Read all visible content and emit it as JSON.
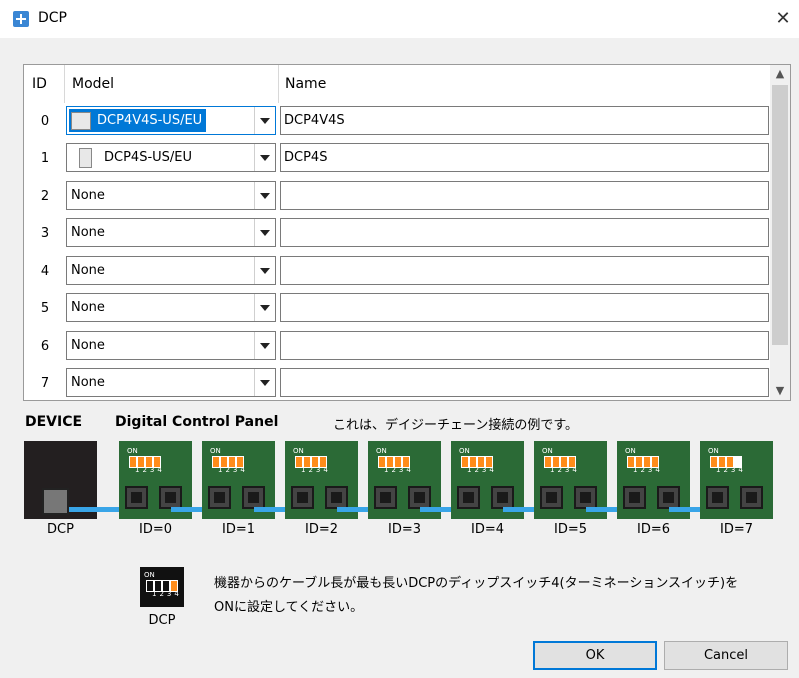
{
  "window": {
    "title": "DCP",
    "close_glyph": "✕"
  },
  "table": {
    "columns": [
      "ID",
      "Model",
      "Name"
    ],
    "rows": [
      {
        "id": "0",
        "model": "DCP4V4S-US/EU",
        "name": "DCP4V4S",
        "icon": "dcp4v4s-icon"
      },
      {
        "id": "1",
        "model": "DCP4S-US/EU",
        "name": "DCP4S",
        "icon": "dcp4s-icon"
      },
      {
        "id": "2",
        "model": "None",
        "name": ""
      },
      {
        "id": "3",
        "model": "None",
        "name": ""
      },
      {
        "id": "4",
        "model": "None",
        "name": ""
      },
      {
        "id": "5",
        "model": "None",
        "name": ""
      },
      {
        "id": "6",
        "model": "None",
        "name": ""
      },
      {
        "id": "7",
        "model": "None",
        "name": ""
      }
    ]
  },
  "diagram": {
    "device_label": "DEVICE",
    "panel_label": "Digital Control Panel",
    "note": "これは、デイジーチェーン接続の例です。",
    "device_port_label": "DCP",
    "id_labels": [
      "ID=0",
      "ID=1",
      "ID=2",
      "ID=3",
      "ID=4",
      "ID=5",
      "ID=6",
      "ID=7"
    ],
    "dip_on": "ON",
    "dip_nums": "1234",
    "cable_color": "#39a5e8"
  },
  "legend": {
    "text": "機器からのケーブル長が最も長いDCPのディップスイッチ4(ターミネーションスイッチ)をONに設定してください。",
    "label": "DCP"
  },
  "buttons": {
    "ok": "OK",
    "cancel": "Cancel"
  }
}
